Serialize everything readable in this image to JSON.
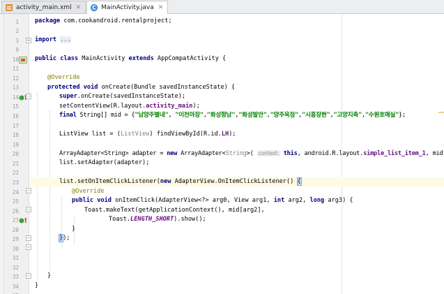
{
  "tabs": [
    {
      "label": "activity_main.xml",
      "icon": "xml-file-icon",
      "active": false
    },
    {
      "label": "MainActivity.java",
      "icon": "java-class-icon",
      "active": true
    }
  ],
  "gutter": {
    "line_numbers": [
      "1",
      "2",
      "3",
      "9",
      "10",
      "11",
      "12",
      "13",
      "14",
      "15",
      "16",
      "17",
      "18",
      "19",
      "20",
      "21",
      "22",
      "23",
      "24",
      "25",
      "26",
      "27",
      "28",
      "29",
      "30",
      "31",
      "32",
      "33",
      "34",
      "35"
    ]
  },
  "code": {
    "l1_kw": "package",
    "l1_rest": " com.cookandroid.rentalproject;",
    "l3_kw": "import",
    "l3_dots": "...",
    "l10_kw1": "public class",
    "l10_name": " MainActivity ",
    "l10_kw2": "extends",
    "l10_rest": " AppCompatActivity {",
    "l12_ann": "@Override",
    "l13_kw": "protected void",
    "l13_rest": " onCreate(Bundle savedInstanceState) {",
    "l14_kw": "super",
    "l14_rest": ".onCreate(savedInstanceState);",
    "l15_pre": "setContentView(R.layout.",
    "l15_fld": "activity_main",
    "l15_post": ");",
    "l16_kw": "final",
    "l16_mid": " String[] mid = {",
    "l16_s1": "\"남양주별내\"",
    "l16_c1": ", ",
    "l16_s2": "\"이천마장\"",
    "l16_c2": ",",
    "l16_s3": "\"화성향남\"",
    "l16_c3": ",",
    "l16_s4": "\"화성발안\"",
    "l16_c4": ",",
    "l16_s5": "\"양주옥정\"",
    "l16_c5": ",",
    "l16_s6": "\"시흥장현\"",
    "l16_c6": ",",
    "l16_s7": "\"고양지축\"",
    "l16_c7": ",",
    "l16_s8": "\"수원호매실\"",
    "l16_end": "};",
    "l18_pre": "ListView list = (",
    "l18_cast": "ListView",
    "l18_mid": ") findViewById(R.id.",
    "l18_fld": "LH",
    "l18_post": ");",
    "l20_pre": "ArrayAdapter<String> adapter = ",
    "l20_kw": "new",
    "l20_mid": " ArrayAdapter<",
    "l20_gen": "String",
    "l20_open": ">( ",
    "l20_hint": "context:",
    "l20_this": " this",
    "l20_mid2": ", android.R.layout.",
    "l20_fld": "simple_list_item_1",
    "l20_post": ", mid);",
    "l21_text": "list.setAdapter(adapter);",
    "l23_pre": "list.setOnItemClickListener(",
    "l23_kw": "new",
    "l23_rest": " AdapterView.OnItemClickListener() ",
    "l23_brace": "{",
    "l24_ann": "@Override",
    "l25_kw": "public void",
    "l25_mid": " onItemClick(AdapterView<?> arg0, View arg1, ",
    "l25_kw2": "int",
    "l25_mid2": " arg2, ",
    "l25_kw3": "long",
    "l25_post": " arg3) {",
    "l26_text": "Toast.makeText(getApplicationContext(), mid[arg2],",
    "l27_pre": "Toast.",
    "l27_fld": "LENGTH_SHORT",
    "l27_post": ").show();",
    "l28_text": "}",
    "l29_brace": "}",
    "l29_post": ");",
    "l33_text": "}",
    "l34_text": "}"
  },
  "colors": {
    "keyword": "#000080",
    "string": "#008000",
    "annotation": "#808000",
    "field": "#660e7a",
    "current_line": "#fffae3"
  }
}
